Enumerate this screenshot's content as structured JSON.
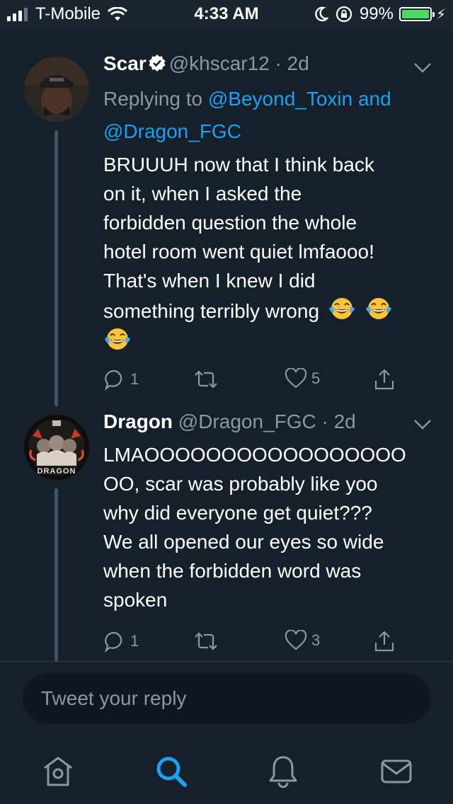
{
  "status_bar": {
    "carrier": "T-Mobile",
    "time": "4:33 AM",
    "battery": "99%",
    "battery_level": 0.99
  },
  "tweets": [
    {
      "name": "Scar",
      "verified": true,
      "handle": "@khscar12",
      "separator": "·",
      "age": "2d",
      "replying_prefix": "Replying to",
      "replying_to_1": "@Beyond_Toxin",
      "replying_and": "and",
      "replying_to_2": "@Dragon_FGC",
      "lines": [
        "BRUUUH now that I think back",
        "on it, when I asked the",
        "forbidden question the whole",
        "hotel room went quiet lmfaooo!",
        "That's when I knew I did",
        "something terribly wrong"
      ],
      "emojis": [
        "face-with-tears-of-joy",
        "face-with-tears-of-joy",
        "face-with-tears-of-joy"
      ],
      "reply_count": "1",
      "like_count": "5"
    },
    {
      "name": "Dragon",
      "handle": "@Dragon_FGC",
      "separator": "·",
      "age": "2d",
      "lines": [
        "LMAOOOOOOOOOOOOOOOOO",
        "OO, scar was probably like yoo",
        "why did everyone get quiet???",
        "We all opened our eyes so wide",
        "when the forbidden word was",
        "spoken"
      ],
      "avatar_label": "DRAGON",
      "reply_count": "1",
      "like_count": "3"
    }
  ],
  "reply_box": {
    "placeholder": "Tweet your reply"
  },
  "tab_bar": {
    "items": [
      "home-icon",
      "search-icon",
      "notifications-icon",
      "messages-icon"
    ],
    "active": "search-icon"
  },
  "colors": {
    "background": "#15202b",
    "accent": "#1da1f2",
    "muted": "#8899a6",
    "battery": "#4cd964"
  }
}
